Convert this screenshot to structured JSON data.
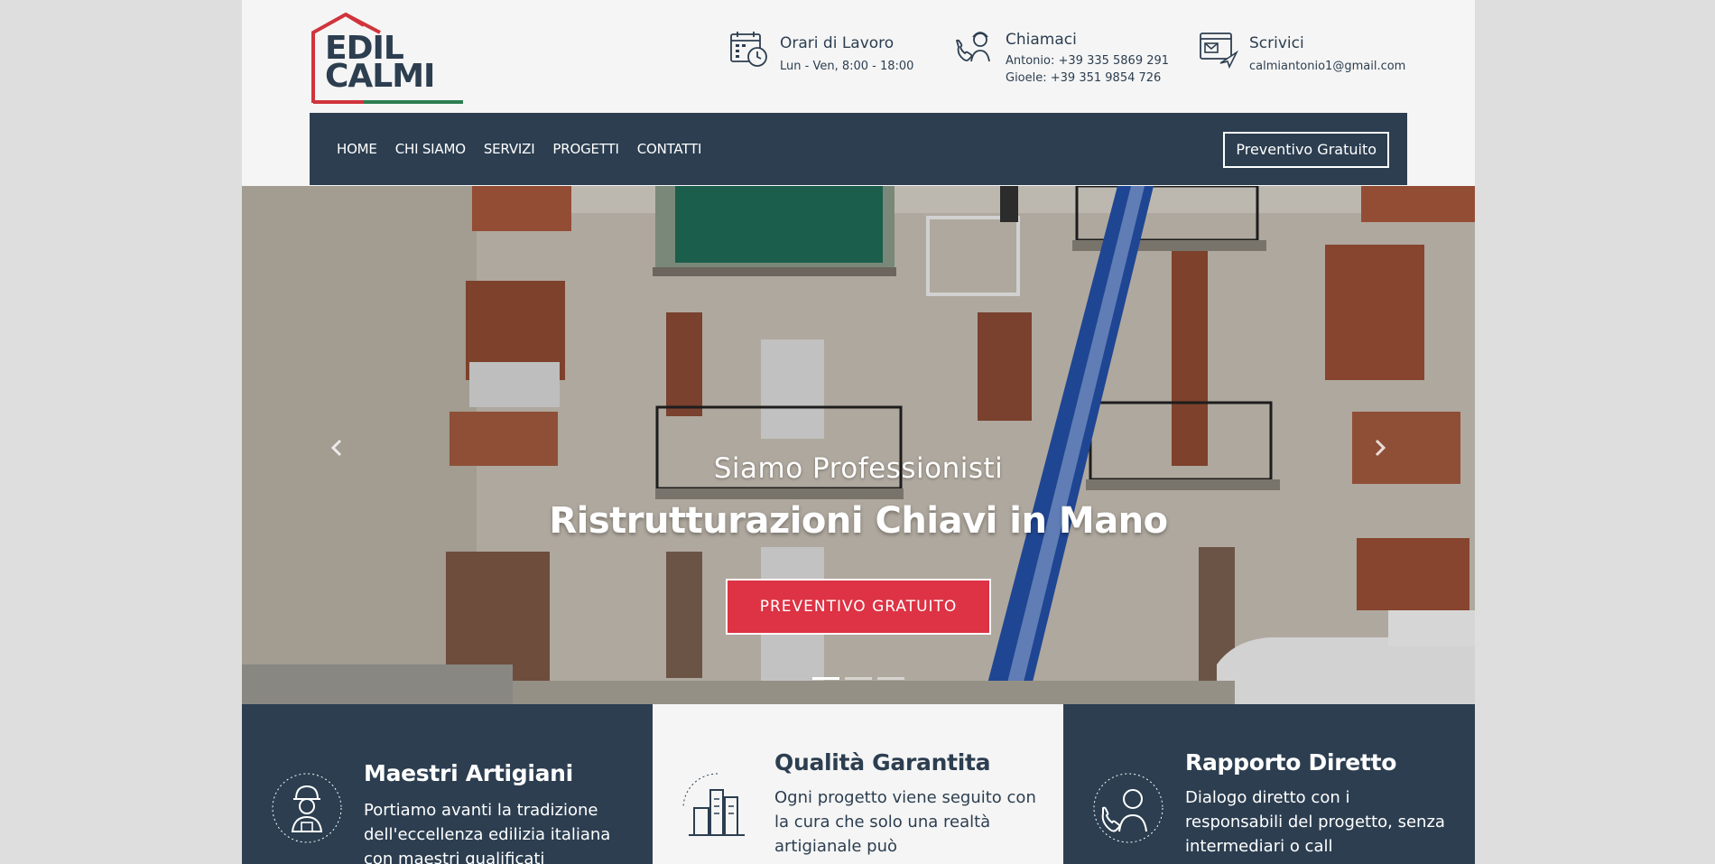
{
  "logo": {
    "line1": "EDIL",
    "line2": "CALMI",
    "colors": {
      "red": "#d0343c",
      "green": "#2e7d52",
      "navy": "#2c3e50"
    }
  },
  "header": {
    "hours": {
      "title": "Orari di Lavoro",
      "detail": "Lun - Ven, 8:00 - 18:00",
      "icon": "calendar-clock-icon"
    },
    "call": {
      "title": "Chiamaci",
      "line1": "Antonio: +39 335 5869 291",
      "line2": "Gioele: +39 351 9854 726",
      "icon": "phone-worker-icon"
    },
    "write": {
      "title": "Scrivici",
      "detail": "calmiantonio1@gmail.com",
      "icon": "email-icon"
    }
  },
  "nav": {
    "items": [
      "HOME",
      "CHI SIAMO",
      "SERVIZI",
      "PROGETTI",
      "CONTATTI"
    ],
    "cta": "Preventivo Gratuito"
  },
  "hero": {
    "subtitle": "Siamo Professionisti",
    "title": "Ristrutturazioni Chiavi in Mano",
    "cta": "PREVENTIVO GRATUITO",
    "slides": 3,
    "active_slide": 1
  },
  "features": [
    {
      "title": "Maestri Artigiani",
      "text": "Portiamo avanti la tradizione dell'eccellenza edilizia italiana con maestri qualificati",
      "icon": "construction-worker-icon"
    },
    {
      "title": "Qualità Garantita",
      "text": "Ogni progetto viene seguito con la cura che solo una realtà artigianale può",
      "icon": "buildings-icon"
    },
    {
      "title": "Rapporto Diretto",
      "text": "Dialogo diretto con i responsabili del progetto, senza intermediari o call",
      "icon": "support-agent-icon"
    }
  ],
  "colors": {
    "navy": "#2c3e50",
    "accent": "#dd3344",
    "light": "#f5f5f5"
  }
}
